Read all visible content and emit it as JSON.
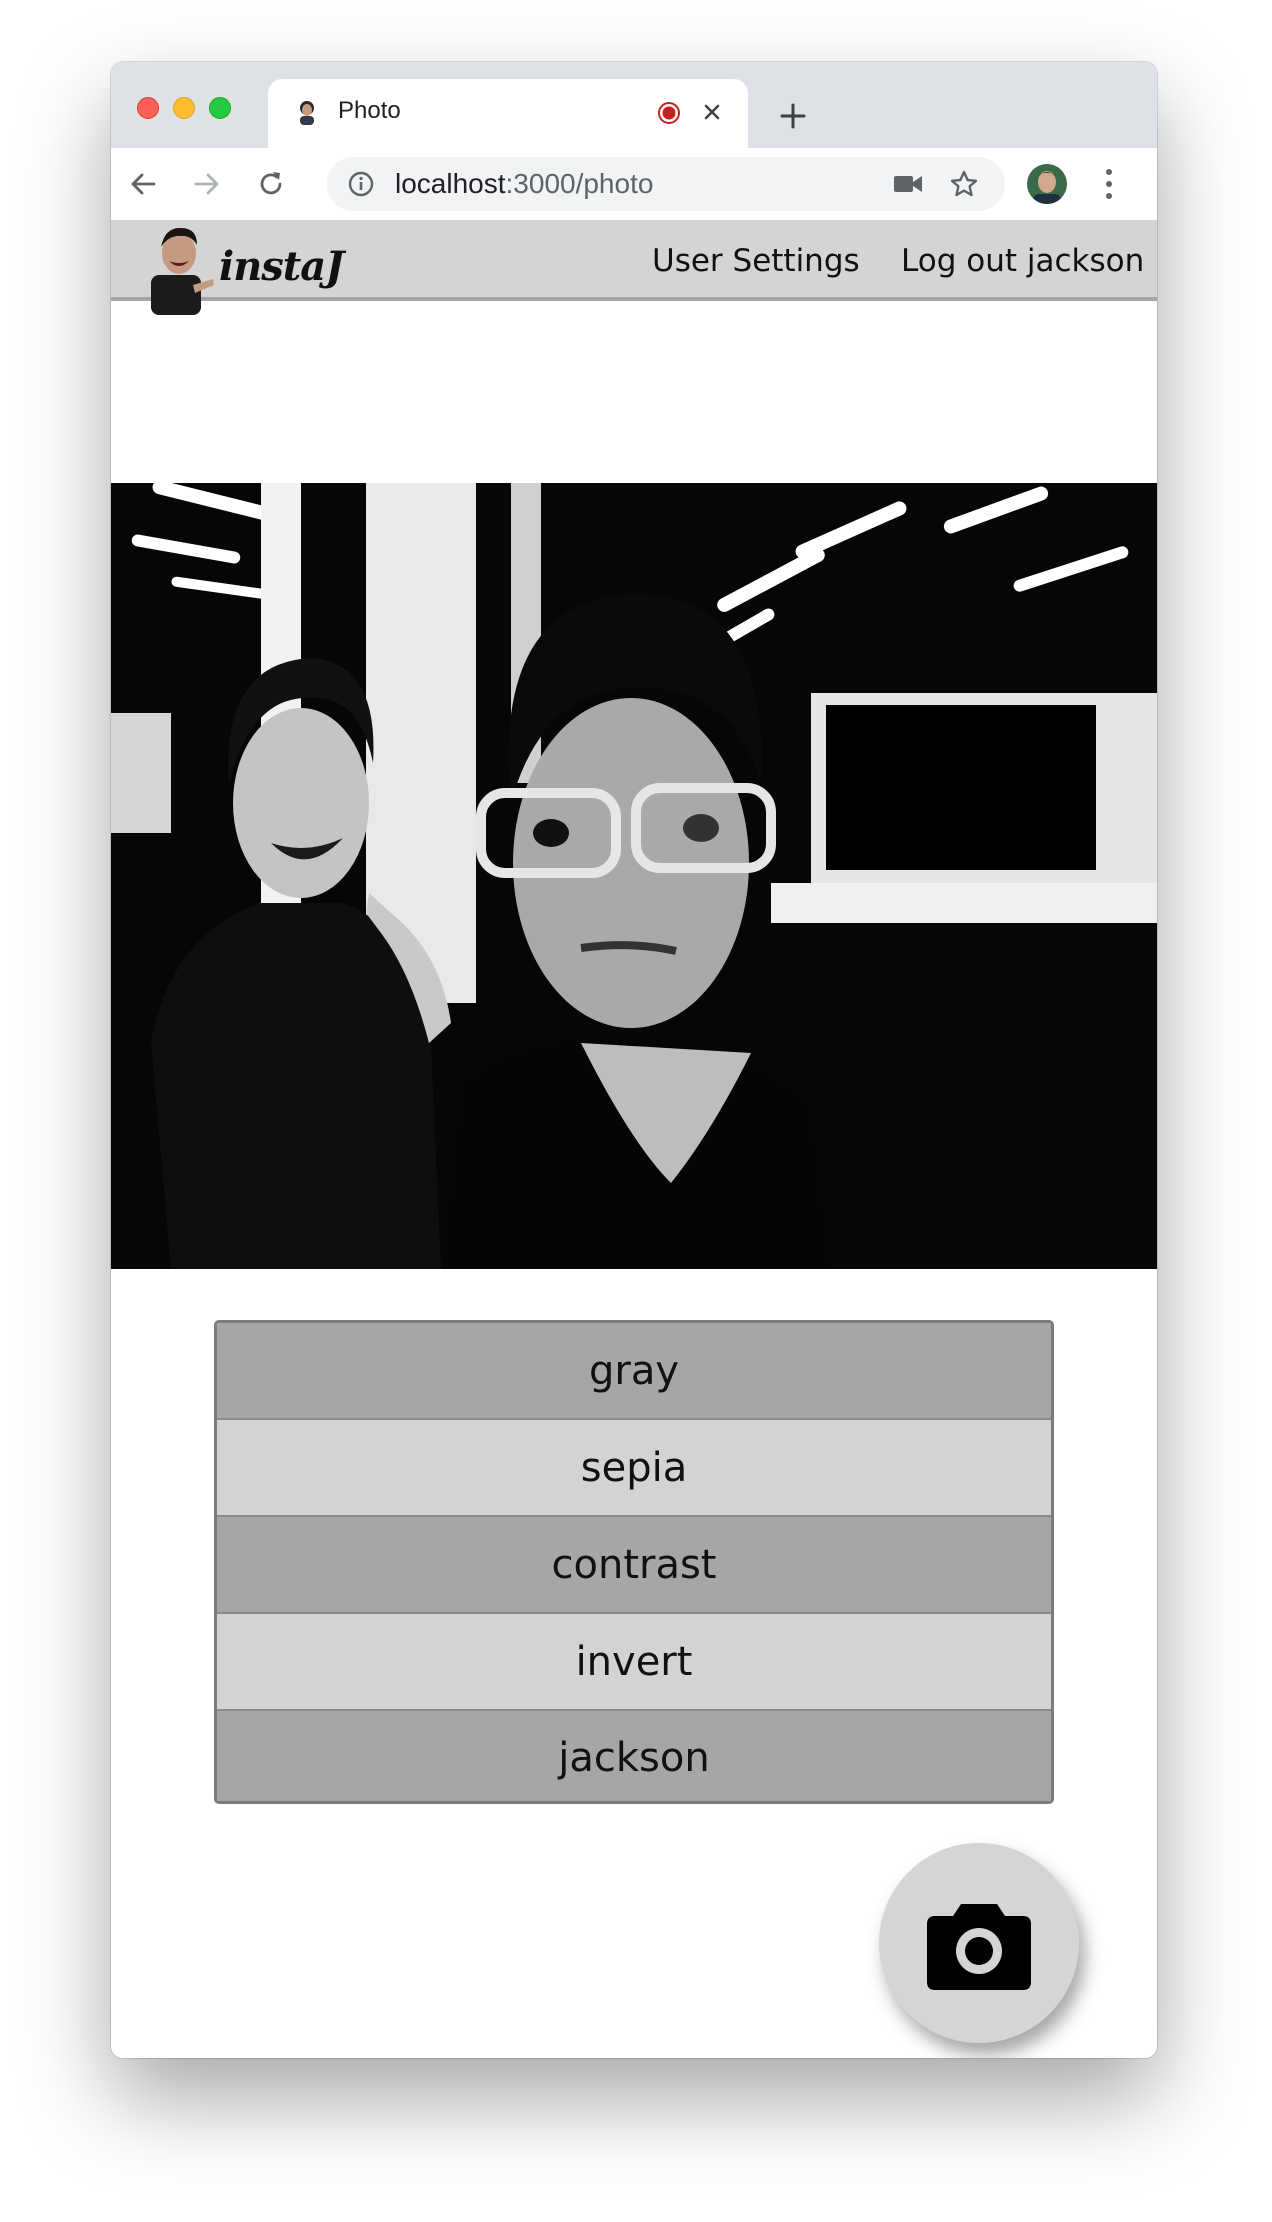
{
  "browser": {
    "tab_title": "Photo",
    "url_host": "localhost",
    "url_path": ":3000/photo"
  },
  "icons": {
    "back": "arrow-left-icon",
    "forward": "arrow-right-icon",
    "reload": "reload-icon",
    "info": "info-icon",
    "camera": "camera-icon",
    "bookmark": "star-icon",
    "menu": "kebab-menu-icon",
    "close": "close-icon",
    "new_tab": "plus-icon",
    "recording": "recording-dot-icon"
  },
  "app": {
    "logo_text": "instaJ",
    "nav": {
      "user_settings": "User Settings",
      "logout": "Log out jackson"
    },
    "filters": [
      "gray",
      "sepia",
      "contrast",
      "invert",
      "jackson"
    ]
  },
  "colors": {
    "appbar_bg": "#d4d4d4",
    "filter_dark": "#a6a6a6",
    "filter_light": "#d3d3d3",
    "shutter_bg": "#d5d5d5"
  }
}
